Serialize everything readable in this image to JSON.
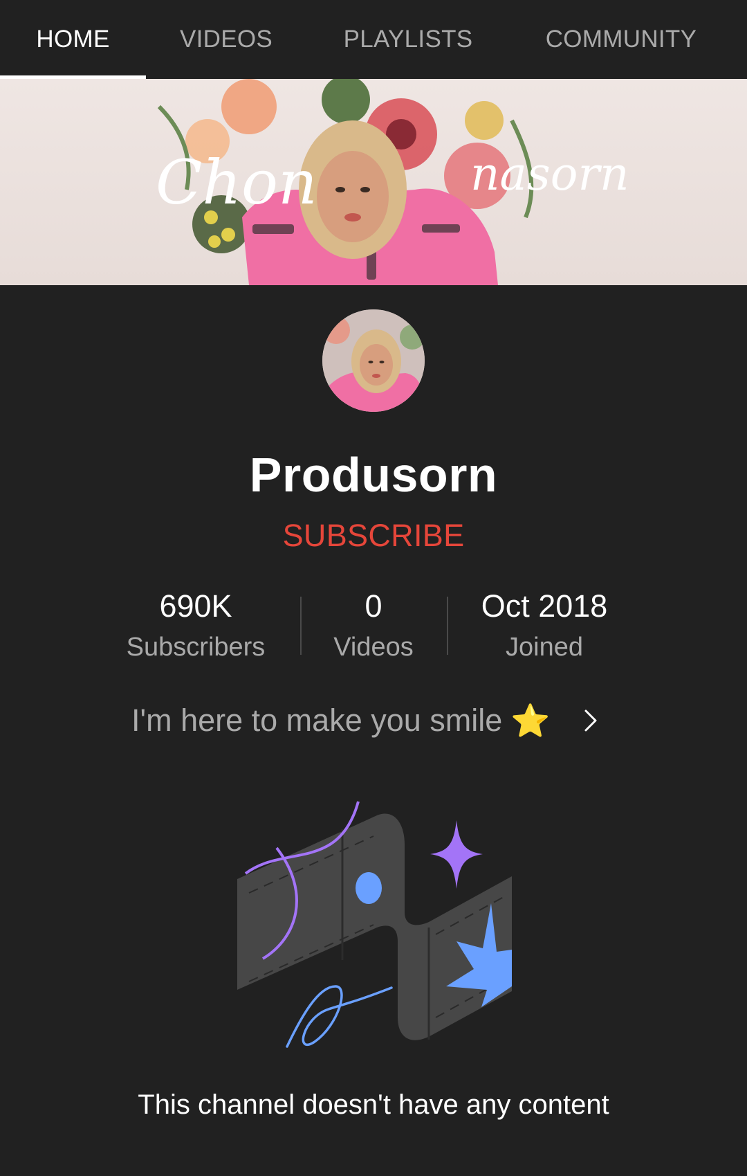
{
  "tabs": [
    {
      "label": "HOME",
      "active": true
    },
    {
      "label": "VIDEOS",
      "active": false
    },
    {
      "label": "PLAYLISTS",
      "active": false
    },
    {
      "label": "COMMUNITY",
      "active": false
    }
  ],
  "banner": {
    "script_text_left": "Chon",
    "script_text_right": "nasorn"
  },
  "channel": {
    "name": "Produsorn",
    "subscribe_label": "SUBSCRIBE"
  },
  "stats": [
    {
      "value": "690K",
      "label": "Subscribers"
    },
    {
      "value": "0",
      "label": "Videos"
    },
    {
      "value": "Oct 2018",
      "label": "Joined"
    }
  ],
  "about": {
    "text": "I'm here to make you smile",
    "emoji": "⭐"
  },
  "empty_state": {
    "message": "This channel doesn't have any content"
  },
  "colors": {
    "background": "#212121",
    "subscribe": "#e6463a",
    "muted_text": "#aaaaaa",
    "illustration_purple": "#a374f7",
    "illustration_blue": "#6aa0ff"
  }
}
